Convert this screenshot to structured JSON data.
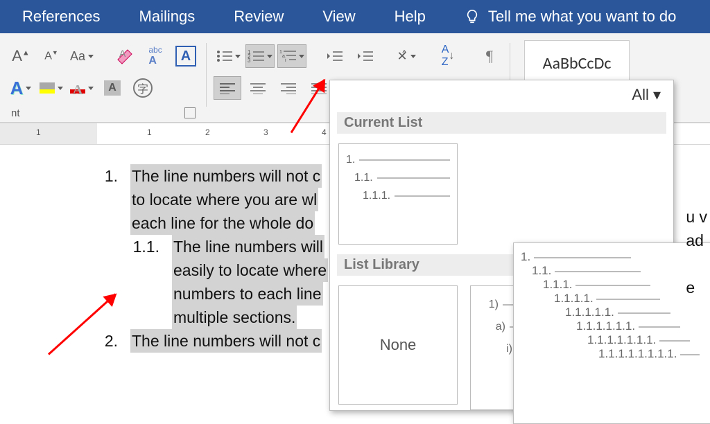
{
  "menubar": {
    "items": [
      "References",
      "Mailings",
      "Review",
      "View",
      "Help"
    ],
    "tell": "Tell me what you want to do"
  },
  "ribbon": {
    "font_group_label": "nt",
    "style_preview": "AaBbCcDc"
  },
  "multilist": {
    "filter": "All",
    "current_header": "Current List",
    "library_header": "List Library",
    "none_label": "None",
    "current_scheme": [
      "1.",
      "1.1.",
      "1.1.1."
    ],
    "lib_scheme_b": [
      "1)",
      "a)",
      "i)"
    ]
  },
  "tooltip_levels": [
    "1.",
    "1.1.",
    "1.1.1.",
    "1.1.1.1.",
    "1.1.1.1.1.",
    "1.1.1.1.1.1.",
    "1.1.1.1.1.1.1.",
    "1.1.1.1.1.1.1.1."
  ],
  "ruler_numbers": [
    "1",
    "1",
    "2",
    "3",
    "4"
  ],
  "document": {
    "items": [
      {
        "num": "1.",
        "lines": [
          "The line numbers will not c",
          "to locate where you are wl",
          "each line for the whole do"
        ]
      },
      {
        "num": "1.1.",
        "lines": [
          "The line numbers will",
          "easily to locate where",
          "numbers to each line",
          "multiple sections."
        ]
      },
      {
        "num": "2.",
        "lines": [
          "The line numbers will not c"
        ]
      }
    ],
    "tail_chars": [
      "u v",
      "ad",
      "e"
    ]
  }
}
